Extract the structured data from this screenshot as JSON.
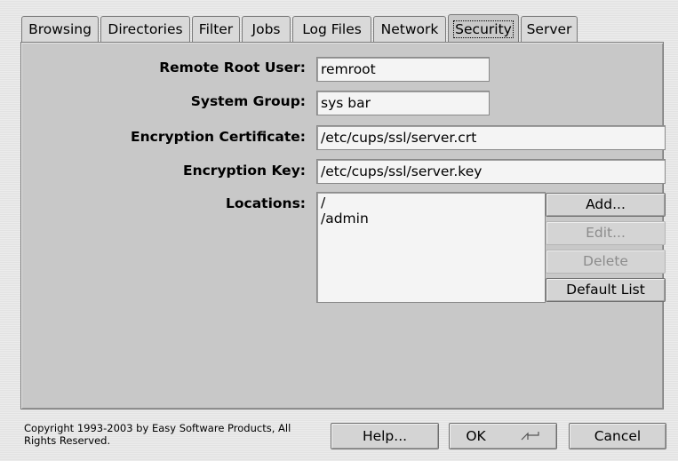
{
  "tabs": [
    {
      "label": "Browsing",
      "active": false
    },
    {
      "label": "Directories",
      "active": false
    },
    {
      "label": "Filter",
      "active": false
    },
    {
      "label": "Jobs",
      "active": false
    },
    {
      "label": "Log Files",
      "active": false
    },
    {
      "label": "Network",
      "active": false
    },
    {
      "label": "Security",
      "active": true
    },
    {
      "label": "Server",
      "active": false
    }
  ],
  "form": {
    "remote_root_user": {
      "label": "Remote Root User:",
      "value": "remroot"
    },
    "system_group": {
      "label": "System Group:",
      "value": "sys bar"
    },
    "encryption_certificate": {
      "label": "Encryption Certificate:",
      "value": "/etc/cups/ssl/server.crt"
    },
    "encryption_key": {
      "label": "Encryption Key:",
      "value": "/etc/cups/ssl/server.key"
    },
    "locations": {
      "label": "Locations:",
      "items": [
        "/",
        "/admin"
      ]
    }
  },
  "location_buttons": {
    "add": "Add...",
    "edit": "Edit...",
    "delete": "Delete",
    "default_list": "Default List"
  },
  "footer": {
    "copyright": "Copyright 1993-2003 by Easy Software Products, All Rights Reserved.",
    "help": "Help...",
    "ok": "OK",
    "cancel": "Cancel"
  },
  "icons": {
    "ok": "enter-key-icon"
  }
}
